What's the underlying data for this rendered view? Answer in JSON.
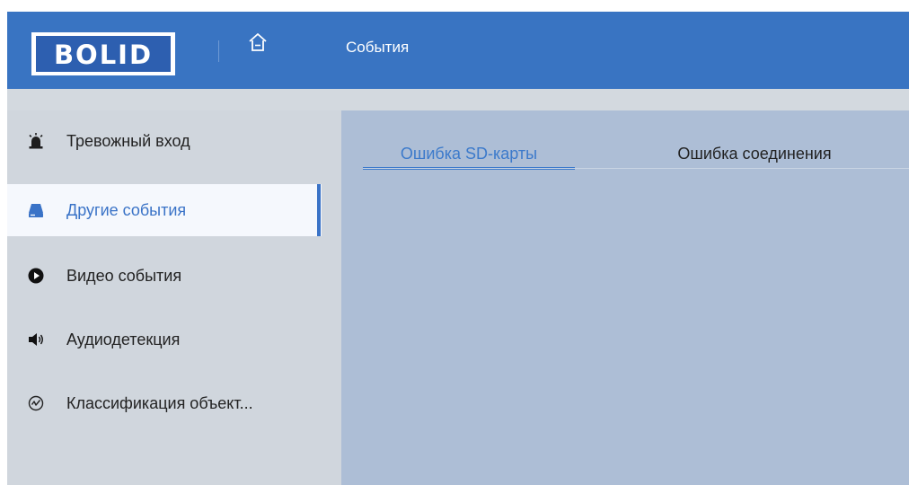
{
  "header": {
    "logo_text": "BOLID",
    "title": "События",
    "home_icon": "home-icon",
    "brand_color": "#3974c2"
  },
  "sidebar": {
    "active_index": 1,
    "accent": "#3a73c7",
    "items": [
      {
        "label": "Тревожный вход",
        "icon": "alarm-light-icon"
      },
      {
        "label": "Другие события",
        "icon": "drive-icon"
      },
      {
        "label": "Видео события",
        "icon": "play-circle-icon"
      },
      {
        "label": "Аудиодетекция",
        "icon": "speaker-icon"
      },
      {
        "label": "Классификация объект...",
        "icon": "object-classification-icon"
      }
    ]
  },
  "main": {
    "tabs": [
      {
        "label": "Ошибка SD-карты",
        "active": true
      },
      {
        "label": "Ошибка соединения",
        "active": false
      }
    ]
  }
}
